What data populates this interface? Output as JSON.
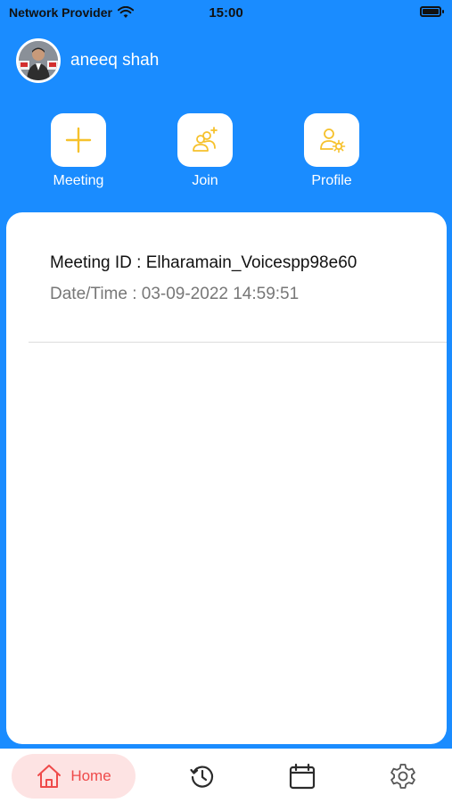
{
  "status": {
    "carrier": "Network Provider",
    "time": "15:00",
    "wifi_icon": "wifi-icon",
    "battery_icon": "battery-icon"
  },
  "user": {
    "name": "aneeq shah",
    "avatar_icon": "avatar-photo"
  },
  "quick_actions": [
    {
      "label": "Meeting",
      "icon": "plus-icon"
    },
    {
      "label": "Join",
      "icon": "users-add-icon"
    },
    {
      "label": "Profile",
      "icon": "user-settings-icon"
    }
  ],
  "meetings": [
    {
      "id_text": "Meeting ID : Elharamain_Voicespp98e60",
      "datetime_text": "Date/Time : 03-09-2022 14:59:51"
    }
  ],
  "tabs": {
    "home": {
      "label": "Home",
      "icon": "home-icon"
    },
    "history": {
      "icon": "history-icon"
    },
    "calendar": {
      "icon": "calendar-icon"
    },
    "settings": {
      "icon": "gear-icon"
    }
  },
  "colors": {
    "header_bg": "#1a8cff",
    "accent_yellow": "#f6c12b",
    "home_active": "#ef4a4a",
    "home_active_bg": "#fde3e3"
  }
}
